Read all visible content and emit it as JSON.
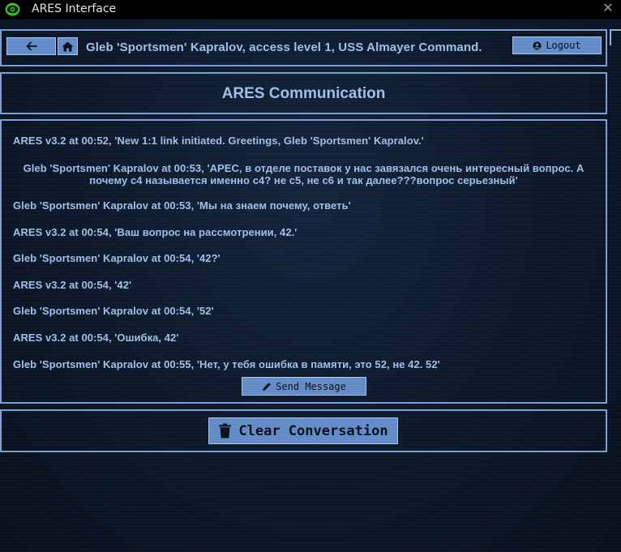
{
  "window": {
    "title": "ARES Interface",
    "close_glyph": "✕",
    "app_icon": "eye-icon"
  },
  "colors": {
    "background": "#0b1626",
    "panel_border": "#7d9fd3",
    "text": "#9ec0ea",
    "button_fill": "#5e88c6",
    "button_text": "#0a1320"
  },
  "header": {
    "back_icon": "arrow-left-icon",
    "home_icon": "home-icon",
    "user_line": "Gleb 'Sportsmen' Kapralov, access level 1, USS Almayer Command.",
    "logout_icon": "user-circle-icon",
    "logout_label": "Logout"
  },
  "page": {
    "title": "ARES Communication"
  },
  "conversation": {
    "messages": [
      "ARES v3.2 at 00:52, 'New 1:1 link initiated. Greetings, Gleb 'Sportsmen' Kapralov.'",
      "Gleb 'Sportsmen' Kapralov at 00:53, 'АРЕС, в отделе поставок у нас завязался очень интересный вопрос. А почему с4 называется именно с4? не с5, не с6 и так далее???вопрос серьезный'",
      "Gleb 'Sportsmen' Kapralov at 00:53, 'Мы на знаем почему, ответь'",
      "ARES v3.2 at 00:54, 'Ваш вопрос на рассмотрении, 42.'",
      "Gleb 'Sportsmen' Kapralov at 00:54, '42?'",
      "ARES v3.2 at 00:54, '42'",
      "Gleb 'Sportsmen' Kapralov at 00:54, '52'",
      "ARES v3.2 at 00:54, 'Ошибка, 42'",
      "Gleb 'Sportsmen' Kapralov at 00:55, 'Нет, у тебя ошибка в памяти, это 52, не 42. 52'"
    ],
    "send_icon": "pencil-icon",
    "send_label": "Send Message"
  },
  "footer": {
    "clear_icon": "trash-icon",
    "clear_label": "Clear Conversation"
  }
}
